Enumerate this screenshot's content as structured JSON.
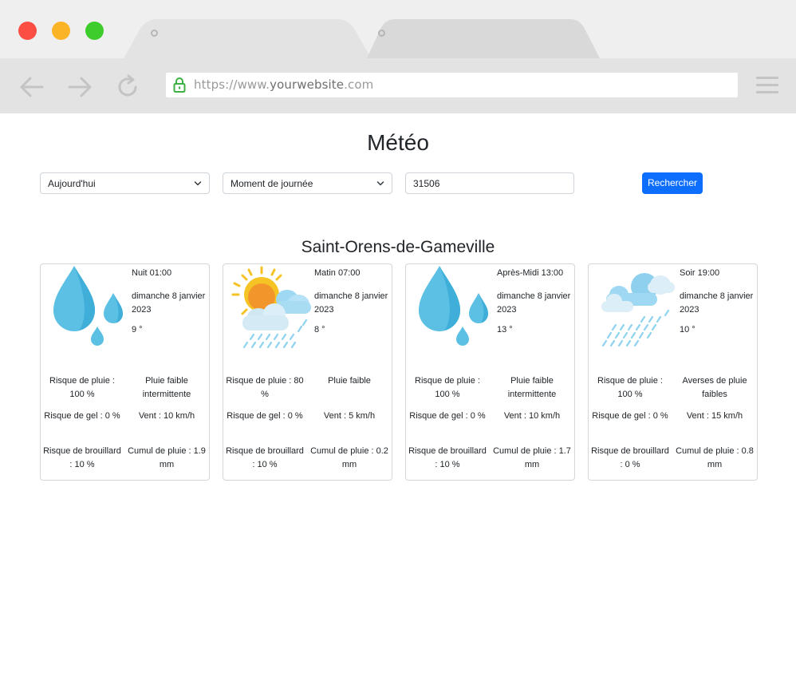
{
  "browser": {
    "url_prefix": "https://www.",
    "url_domain": "yourwebsite",
    "url_suffix": ".com"
  },
  "page": {
    "title": "Météo",
    "day_select": "Aujourd'hui",
    "moment_select": "Moment de journée",
    "postcode": "31506",
    "search_label": "Rechercher",
    "city": "Saint-Orens-de-Gameville"
  },
  "cards": [
    {
      "icon": "rain-drops-icon",
      "moment": "Nuit 01:00",
      "date": "dimanche 8 janvier 2023",
      "temp": "9 °",
      "rain_risk": "Risque de pluie : 100 %",
      "condition": "Pluie faible intermittente",
      "frost_risk": "Risque de gel : 0 %",
      "wind": "Vent : 10 km/h",
      "fog_risk": "Risque de brouillard : 10 %",
      "rain_total": "Cumul de pluie : 1.9 mm"
    },
    {
      "icon": "sun-cloud-rain-icon",
      "moment": "Matin 07:00",
      "date": "dimanche 8 janvier 2023",
      "temp": "8 °",
      "rain_risk": "Risque de pluie : 80 %",
      "condition": "Pluie faible",
      "frost_risk": "Risque de gel : 0 %",
      "wind": "Vent : 5 km/h",
      "fog_risk": "Risque de brouillard : 10 %",
      "rain_total": "Cumul de pluie : 0.2 mm"
    },
    {
      "icon": "rain-drops-icon",
      "moment": "Après-Midi 13:00",
      "date": "dimanche 8 janvier 2023",
      "temp": "13 °",
      "rain_risk": "Risque de pluie : 100 %",
      "condition": "Pluie faible intermittente",
      "frost_risk": "Risque de gel : 0 %",
      "wind": "Vent : 10 km/h",
      "fog_risk": "Risque de brouillard : 10 %",
      "rain_total": "Cumul de pluie : 1.7 mm"
    },
    {
      "icon": "cloud-rain-icon",
      "moment": "Soir 19:00",
      "date": "dimanche 8 janvier 2023",
      "temp": "10 °",
      "rain_risk": "Risque de pluie : 100 %",
      "condition": "Averses de pluie faibles",
      "frost_risk": "Risque de gel : 0 %",
      "wind": "Vent : 15 km/h",
      "fog_risk": "Risque de brouillard : 0 %",
      "rain_total": "Cumul de pluie : 0.8 mm"
    }
  ],
  "colors": {
    "accent": "#0d6efd",
    "drop": "#5bc0e4",
    "sun": "#f6c324"
  }
}
